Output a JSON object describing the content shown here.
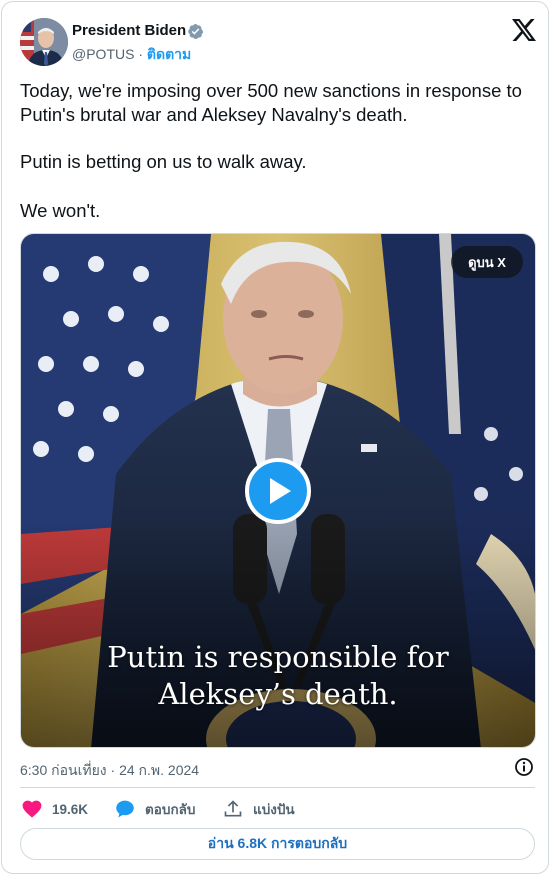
{
  "author": {
    "name": "President Biden",
    "handle": "@POTUS",
    "separator": "·",
    "follow_label": "ติดตาม",
    "verified": true
  },
  "tweet": {
    "paragraphs": [
      "Today, we're imposing over 500 new sanctions in response to Putin's brutal war and Aleksey Navalny's death.",
      "Putin is betting on us to walk away.",
      "We won't."
    ]
  },
  "media": {
    "watch_on_x_label": "ดูบน X",
    "caption_line1": "Putin is responsible for",
    "caption_line2": "Aleksey’s death."
  },
  "meta": {
    "timestamp": "6:30 ก่อนเที่ยง · 24 ก.พ. 2024"
  },
  "actions": {
    "likes": "19.6K",
    "reply_label": "ตอบกลับ",
    "share_label": "แบ่งปัน"
  },
  "read_replies_label": "อ่าน 6.8K การตอบกลับ",
  "colors": {
    "accent": "#1d9bf0",
    "like": "#f91880",
    "text": "#0f1419",
    "muted": "#536471",
    "border": "#cfd9de"
  }
}
